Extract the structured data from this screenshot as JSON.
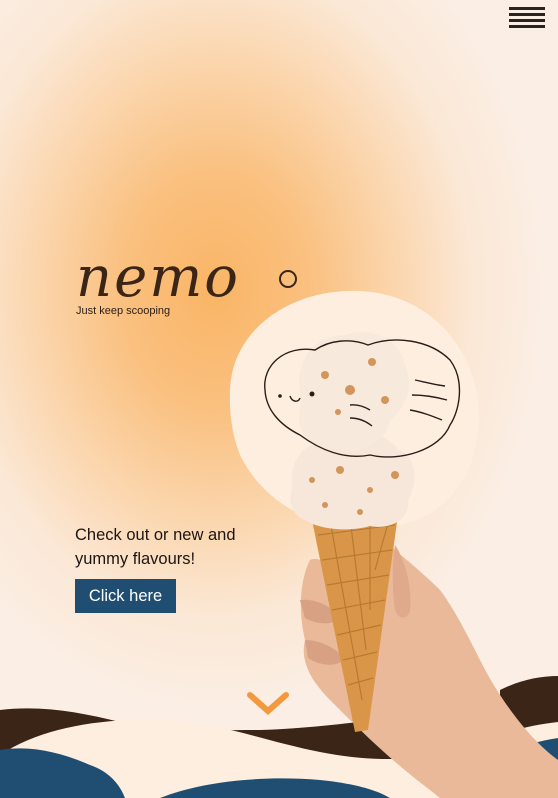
{
  "brand": {
    "logo_text": "nemo",
    "tagline": "Just keep scooping"
  },
  "nav": {
    "menu_icon": "hamburger-menu-icon"
  },
  "promo": {
    "text": "Check out or new and yummy flavours!",
    "cta_label": "Click here"
  },
  "scroll": {
    "icon": "chevron-down-icon"
  },
  "colors": {
    "brown": "#3a2516",
    "navy": "#1f4e72",
    "cream": "#fdeee0",
    "orange": "#f2993f",
    "glow": "#f9b566"
  }
}
